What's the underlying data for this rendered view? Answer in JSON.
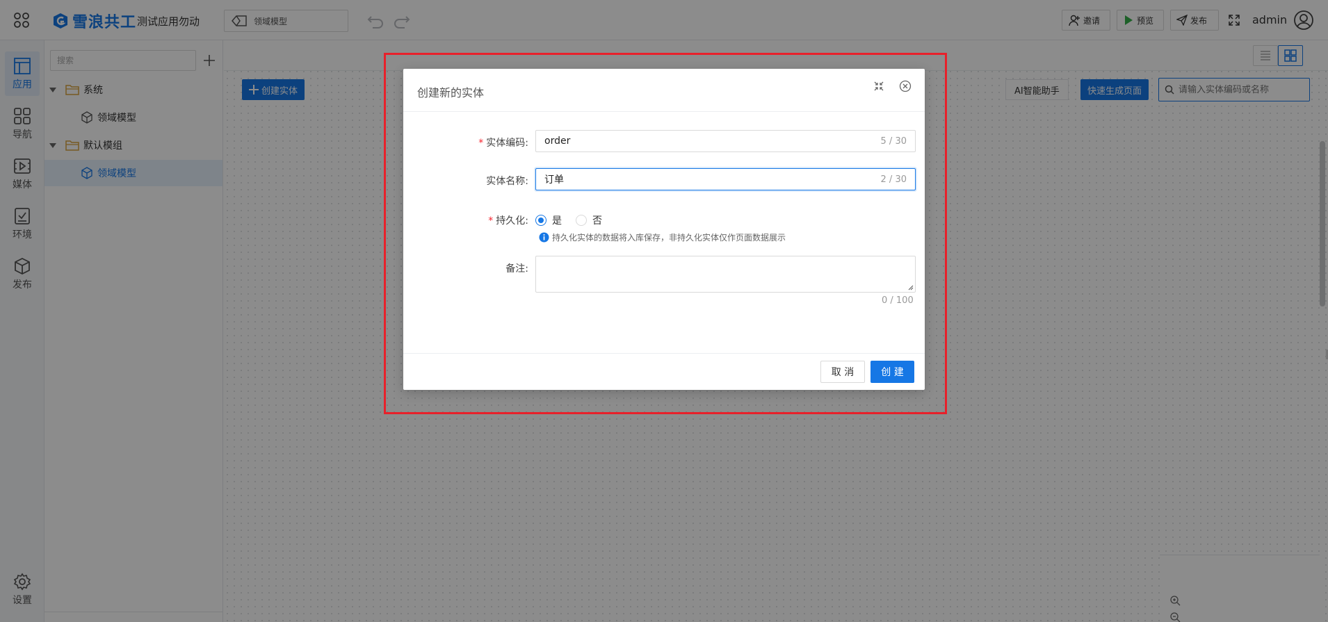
{
  "header": {
    "logo_text": "雪浪共工",
    "app_name": "测试应用勿动",
    "model_select": "领域模型",
    "invite": "邀请",
    "preview": "预览",
    "publish": "发布",
    "user": "admin"
  },
  "rail": {
    "items": [
      {
        "label": "应用",
        "icon": "app-layout-icon"
      },
      {
        "label": "导航",
        "icon": "grid-icon"
      },
      {
        "label": "媒体",
        "icon": "media-icon"
      },
      {
        "label": "环境",
        "icon": "environment-icon"
      },
      {
        "label": "发布",
        "icon": "cube-icon"
      },
      {
        "label": "设置",
        "icon": "gear-icon"
      }
    ]
  },
  "tree": {
    "search_placeholder": "搜索",
    "nodes": [
      {
        "label": "系统",
        "type": "folder"
      },
      {
        "label": "领域模型",
        "type": "model"
      },
      {
        "label": "默认模组",
        "type": "folder"
      },
      {
        "label": "领域模型",
        "type": "model",
        "selected": true
      }
    ]
  },
  "main": {
    "create_entity": "创建实体",
    "ai_assistant": "AI智能助手",
    "quick_generate": "快速生成页面",
    "search_placeholder": "请输入实体编码或名称"
  },
  "dialog": {
    "title": "创建新的实体",
    "code_label": "实体编码:",
    "code_value": "order",
    "code_count": "5 / 30",
    "name_label": "实体名称:",
    "name_value": "订单",
    "name_count": "2 / 30",
    "persist_label": "持久化:",
    "persist_yes": "是",
    "persist_no": "否",
    "persist_hint": "持久化实体的数据将入库保存，非持久化实体仅作页面数据展示",
    "remark_label": "备注:",
    "remark_count": "0 / 100",
    "cancel": "取 消",
    "create": "创 建"
  },
  "colors": {
    "primary": "#1677e5",
    "highlight_border": "#e8202a",
    "required": "#f5222d"
  }
}
